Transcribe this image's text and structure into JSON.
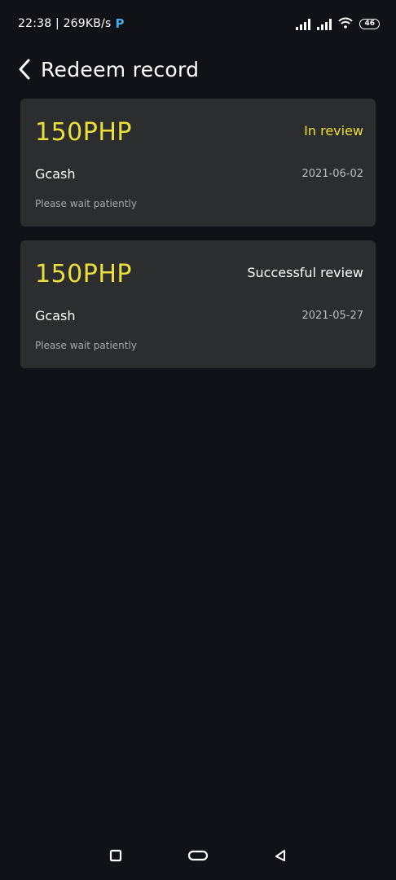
{
  "status_bar": {
    "time_speed": "22:38 | 269KB/s",
    "p_icon": "P",
    "battery": "46"
  },
  "header": {
    "title": "Redeem record"
  },
  "records": [
    {
      "amount": "150PHP",
      "status": "In review",
      "method": "Gcash",
      "date": "2021-06-02",
      "note": "Please wait patiently"
    },
    {
      "amount": "150PHP",
      "status": "Successful review",
      "method": "Gcash",
      "date": "2021-05-27",
      "note": "Please wait patiently"
    }
  ],
  "colors": {
    "background": "#111218",
    "card": "#2b2d2e",
    "accent_yellow": "#ecdf3c"
  },
  "icons": {
    "back": "chevron-left-icon",
    "recents": "square-icon",
    "home": "pill-icon",
    "nav_back": "triangle-left-icon"
  }
}
